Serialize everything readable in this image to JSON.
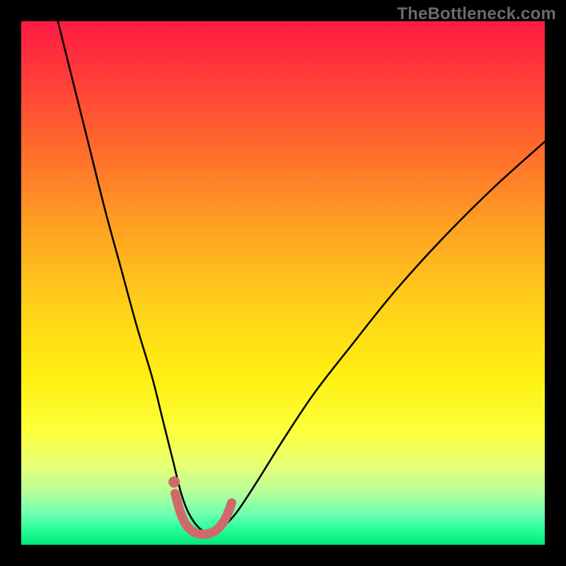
{
  "watermark": "TheBottleneck.com",
  "chart_data": {
    "type": "line",
    "title": "",
    "xlabel": "",
    "ylabel": "",
    "xlim": [
      0,
      100
    ],
    "ylim": [
      0,
      100
    ],
    "grid": false,
    "legend": false,
    "annotations": [],
    "series": [
      {
        "name": "bottleneck-curve",
        "color": "#000000",
        "stroke_width": 2.6,
        "x": [
          7,
          10,
          13,
          16,
          19,
          22,
          25,
          27,
          29,
          30.5,
          32,
          34,
          36,
          38,
          41,
          45,
          50,
          56,
          63,
          71,
          80,
          90,
          100
        ],
        "values": [
          100,
          88,
          76,
          64,
          53,
          42,
          32,
          24,
          16,
          10,
          6,
          3.2,
          2.2,
          3.0,
          6,
          12,
          20,
          29,
          38,
          48,
          58,
          68,
          77
        ]
      },
      {
        "name": "highlight-band",
        "color": "#cf6a6a",
        "stroke_width": 13,
        "x": [
          29.4,
          30.4,
          31.5,
          33,
          34.5,
          36,
          37.5,
          39,
          40.2
        ],
        "values": [
          9.8,
          6.2,
          3.8,
          2.4,
          2.0,
          2.2,
          3.0,
          5.0,
          8.0
        ]
      },
      {
        "name": "highlight-dot",
        "type": "scatter",
        "color": "#cf6a6a",
        "radius": 8,
        "x": [
          29.2
        ],
        "values": [
          12.0
        ]
      }
    ]
  }
}
